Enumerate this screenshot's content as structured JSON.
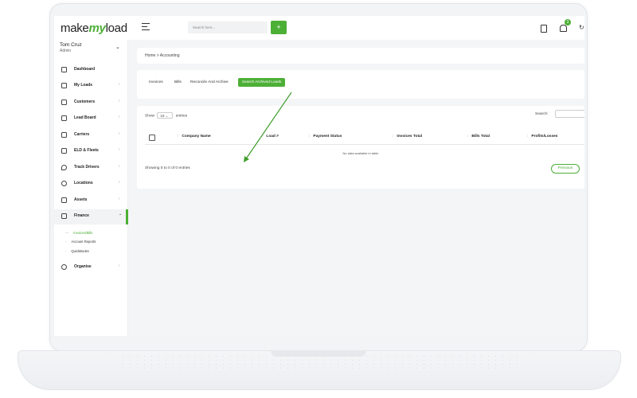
{
  "app": {
    "logo_make": "make",
    "logo_my": "my",
    "logo_load": "load",
    "search_placeholder": "Search here...",
    "search_button": "+",
    "notification_count": "3",
    "refresh_glyph": "↻"
  },
  "user": {
    "name": "Tom Cruz",
    "role": "Admin",
    "chevron": "⌄"
  },
  "sidebar": {
    "items": [
      {
        "label": "Dashboard",
        "icon": "gauge-icon"
      },
      {
        "label": "My Loads",
        "icon": "route-icon",
        "chevron": "›"
      },
      {
        "label": "Customers",
        "icon": "users-icon",
        "chevron": "›"
      },
      {
        "label": "Lead Board",
        "icon": "chart-icon",
        "chevron": "›"
      },
      {
        "label": "Carriers",
        "icon": "truck-icon",
        "chevron": "›"
      },
      {
        "label": "ELD & Fleets",
        "icon": "truck-icon",
        "chevron": "›"
      },
      {
        "label": "Track Drivers",
        "icon": "location-pin-icon",
        "chevron": "›"
      },
      {
        "label": "Locations",
        "icon": "map-pin-icon",
        "chevron": "›"
      },
      {
        "label": "Assets",
        "icon": "bag-icon",
        "chevron": "›"
      },
      {
        "label": "Finance",
        "icon": "wallet-icon",
        "chevron": "⌄"
      },
      {
        "label": "Organise",
        "icon": "gear-icon",
        "chevron": "›"
      }
    ],
    "finance_sub": [
      {
        "label": "Invoices/Bills",
        "marker": "---"
      },
      {
        "label": "Account Reports",
        "marker": "-"
      },
      {
        "label": "QuickBooks",
        "marker": "-"
      }
    ]
  },
  "breadcrumb": "Home > Accounting",
  "tabs": [
    "Invoices",
    "Bills",
    "Reconcile And Archive",
    "Search Archived Loads"
  ],
  "table": {
    "show_prefix": "Show",
    "show_value": "10",
    "show_suffix": "entries",
    "search_label": "Search:",
    "columns": [
      "Company Name",
      "Load #",
      "Payment Status",
      "Invoices Total",
      "Bills Total",
      "Profits/Losses"
    ],
    "sort_glyph": "↕",
    "empty_text": "No data available in table",
    "showing_text": "Showing 0 to 0 of 0 entries",
    "previous_label": "Previous"
  },
  "colors": {
    "accent": "#4caf36"
  }
}
